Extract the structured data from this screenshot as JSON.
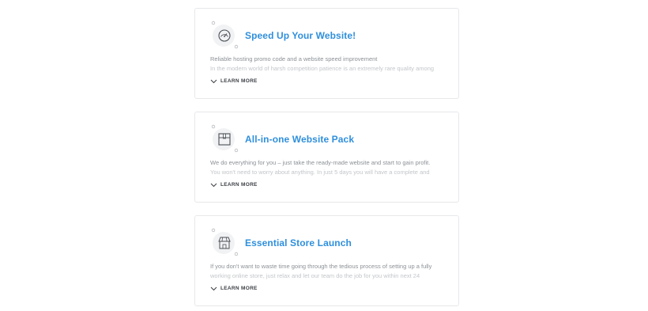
{
  "cards": [
    {
      "icon": "speedometer-icon",
      "title": "Speed Up Your Website!",
      "desc_line1": "Reliable hosting promo code and a website speed improvement",
      "desc_line2": "In the modern world of harsh competition patience is an extremely rare quality among",
      "learn_more": "LEARN MORE"
    },
    {
      "icon": "box-icon",
      "title": "All-in-one Website Pack",
      "desc_line1": "We do everything for you – just take the ready-made website and start to gain profit.",
      "desc_line2": "You won't need to worry about anything. In just 5 days you will have a complete and",
      "learn_more": "LEARN MORE"
    },
    {
      "icon": "store-icon",
      "title": "Essential Store Launch",
      "desc_line1": "If you don't want to waste time going through the tedious process of setting up a fully",
      "desc_line2": "working online store, just relax and let our team do the job for you within next 24",
      "learn_more": "LEARN MORE"
    }
  ],
  "colors": {
    "title": "#2f8fdc",
    "text": "#8c9196",
    "border": "#e6e8eb"
  }
}
